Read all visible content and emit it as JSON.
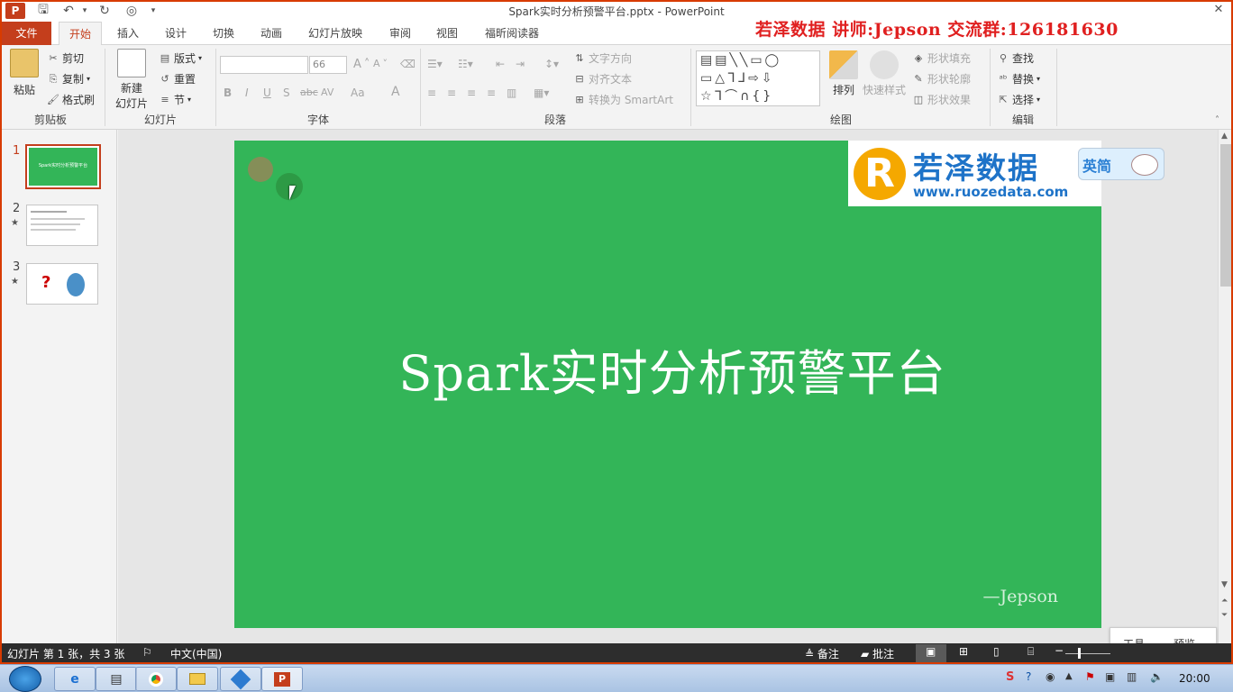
{
  "app": {
    "title": "Spark实时分析预警平台.pptx - PowerPoint",
    "brand_color": "#c43e1c",
    "app_icon": "P"
  },
  "overlay_banner": "若泽数据    讲师:Jepson    交流群:126181630",
  "tabs": [
    "文件",
    "开始",
    "插入",
    "设计",
    "切换",
    "动画",
    "幻灯片放映",
    "审阅",
    "视图",
    "福昕阅读器"
  ],
  "ribbon": {
    "clipboard": {
      "paste": "粘贴",
      "cut": "剪切",
      "copy": "复制",
      "format_painter": "格式刷",
      "label": "剪贴板"
    },
    "slides": {
      "new_slide_line1": "新建",
      "new_slide_line2": "幻灯片",
      "layout": "版式",
      "reset": "重置",
      "section": "节",
      "label": "幻灯片"
    },
    "font": {
      "size": "66",
      "label": "字体",
      "bold": "B",
      "italic": "I",
      "underline": "U",
      "shadow": "S",
      "strike": "abc",
      "spacing": "AV",
      "case": "Aa",
      "color": "A",
      "grow": "A",
      "shrink": "A"
    },
    "paragraph": {
      "text_direction": "文字方向",
      "align_text": "对齐文本",
      "smartart": "转换为 SmartArt",
      "label": "段落"
    },
    "drawing": {
      "arrange": "排列",
      "quick_styles": "快速样式",
      "fill": "形状填充",
      "outline": "形状轮廓",
      "effects": "形状效果",
      "label": "绘图"
    },
    "editing": {
      "find": "查找",
      "replace": "替换",
      "select": "选择",
      "label": "编辑"
    }
  },
  "thumbnails": [
    {
      "num": "1",
      "star": "",
      "selected": true
    },
    {
      "num": "2",
      "star": "★",
      "selected": false
    },
    {
      "num": "3",
      "star": "★",
      "selected": false
    }
  ],
  "slide": {
    "title": "Spark实时分析预警平台",
    "author": "—Jepson",
    "bg_color": "#33b558",
    "logo_letter": "R",
    "logo_text": "若泽数据",
    "logo_url": "www.ruozedata.com"
  },
  "ime": {
    "label": "英简"
  },
  "statusbar": {
    "slide_info": "幻灯片 第 1 张，共 3 张",
    "language": "中文(中国)",
    "notes": "备注",
    "comments": "批注"
  },
  "popup": {
    "tools": "工具",
    "preview": "预览"
  },
  "taskbar": {
    "clock": "20:00"
  }
}
